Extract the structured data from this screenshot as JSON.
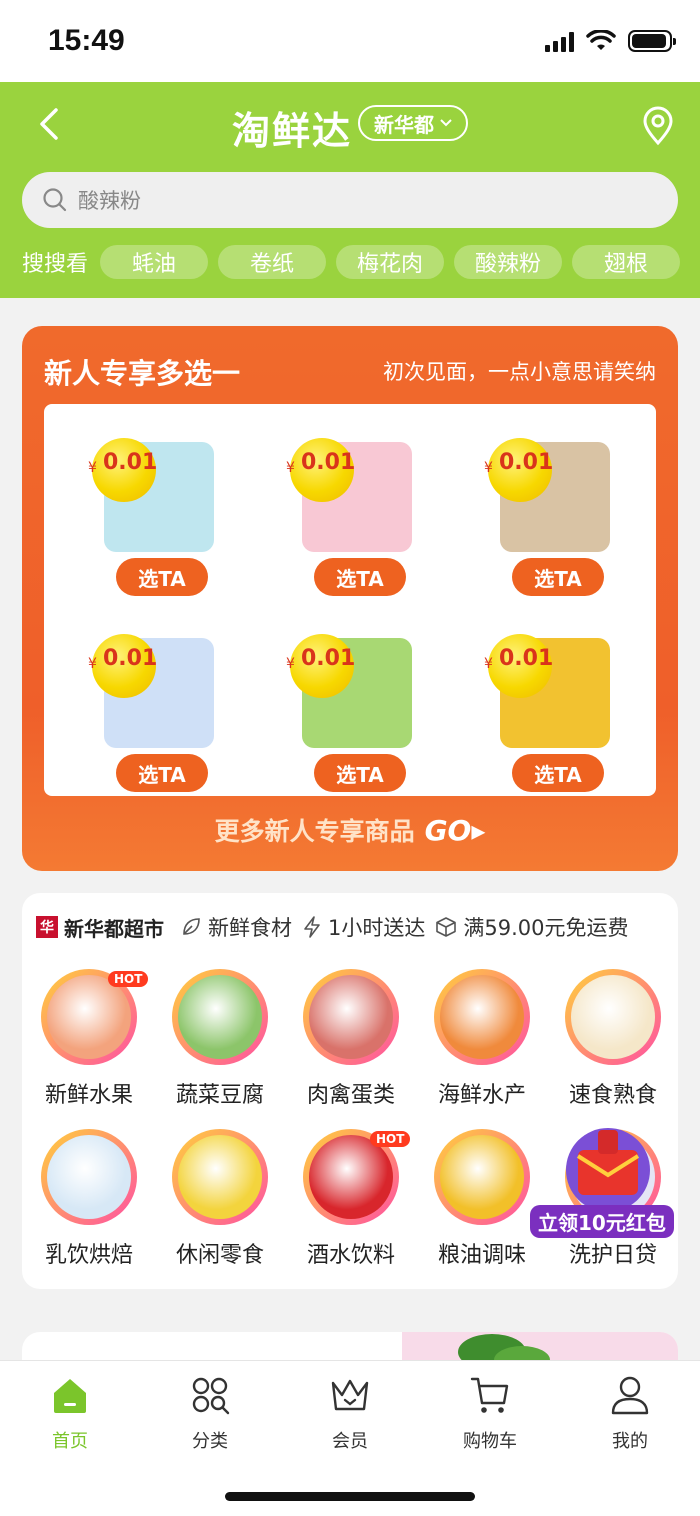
{
  "status_bar": {
    "time": "15:49"
  },
  "header": {
    "brand": "淘鲜达",
    "store": "新华都",
    "search_placeholder": "酸辣粉",
    "hot_label": "搜搜看",
    "hot_tags": [
      "蚝油",
      "卷纸",
      "梅花肉",
      "酸辣粉",
      "翅根"
    ]
  },
  "promo": {
    "title": "新人专享多选一",
    "subtitle": "初次见面，一点小意思请笑纳",
    "currency": "¥",
    "products": [
      {
        "price": "0.01",
        "button": "选TA",
        "icon": "tissue-pack-icon",
        "color": "#bfe6ef"
      },
      {
        "price": "0.01",
        "button": "选TA",
        "icon": "orange-fruit-icon",
        "color": "#f8c8d4"
      },
      {
        "price": "0.01",
        "button": "选TA",
        "icon": "eggs-basket-icon",
        "color": "#d9c3a4"
      },
      {
        "price": "0.01",
        "button": "选TA",
        "icon": "milk-carton-icon",
        "color": "#cfe0f7"
      },
      {
        "price": "0.01",
        "button": "选TA",
        "icon": "lettuce-icon",
        "color": "#a8d873"
      },
      {
        "price": "0.01",
        "button": "选TA",
        "icon": "sunflower-seeds-icon",
        "color": "#f2c230"
      }
    ],
    "more_label": "更多新人专享商品",
    "go_label": "GO▸"
  },
  "store_card": {
    "logo_text": "华",
    "name": "新华都超市",
    "features": [
      "新鲜食材",
      "1小时送达",
      "满59.00元免运费"
    ],
    "categories": [
      {
        "label": "新鲜水果",
        "icon": "grapefruit-icon",
        "hot": "HOT",
        "color": "#f3a37d"
      },
      {
        "label": "蔬菜豆腐",
        "icon": "vegetables-icon",
        "hot": "",
        "color": "#8cc56a"
      },
      {
        "label": "肉禽蛋类",
        "icon": "meat-icon",
        "hot": "",
        "color": "#d9726a"
      },
      {
        "label": "海鲜水产",
        "icon": "crab-icon",
        "hot": "",
        "color": "#f08a3c"
      },
      {
        "label": "速食熟食",
        "icon": "dumplings-icon",
        "hot": "",
        "color": "#f5e7c9"
      },
      {
        "label": "乳饮烘焙",
        "icon": "milk-box-icon",
        "hot": "",
        "color": "#d7e8f6"
      },
      {
        "label": "休闲零食",
        "icon": "chips-can-icon",
        "hot": "",
        "color": "#f3d43d"
      },
      {
        "label": "酒水饮料",
        "icon": "cola-can-icon",
        "hot": "HOT",
        "color": "#d8262c"
      },
      {
        "label": "粮油调味",
        "icon": "oil-bottle-icon",
        "hot": "",
        "color": "#f2c029"
      },
      {
        "label": "洗护日贷",
        "icon": "detergent-icon",
        "hot": "",
        "color": "#e5e5f5"
      }
    ],
    "red_packet": "立领10元红包"
  },
  "tabbar": {
    "tabs": [
      {
        "label": "首页",
        "icon": "home-icon",
        "active": true
      },
      {
        "label": "分类",
        "icon": "category-icon",
        "active": false
      },
      {
        "label": "会员",
        "icon": "crown-icon",
        "active": false
      },
      {
        "label": "购物车",
        "icon": "cart-icon",
        "active": false
      },
      {
        "label": "我的",
        "icon": "profile-icon",
        "active": false
      }
    ]
  },
  "colors": {
    "brand_green": "#9ad33e",
    "promo_orange": "#f06a2c",
    "active_tab": "#7bc52b"
  }
}
